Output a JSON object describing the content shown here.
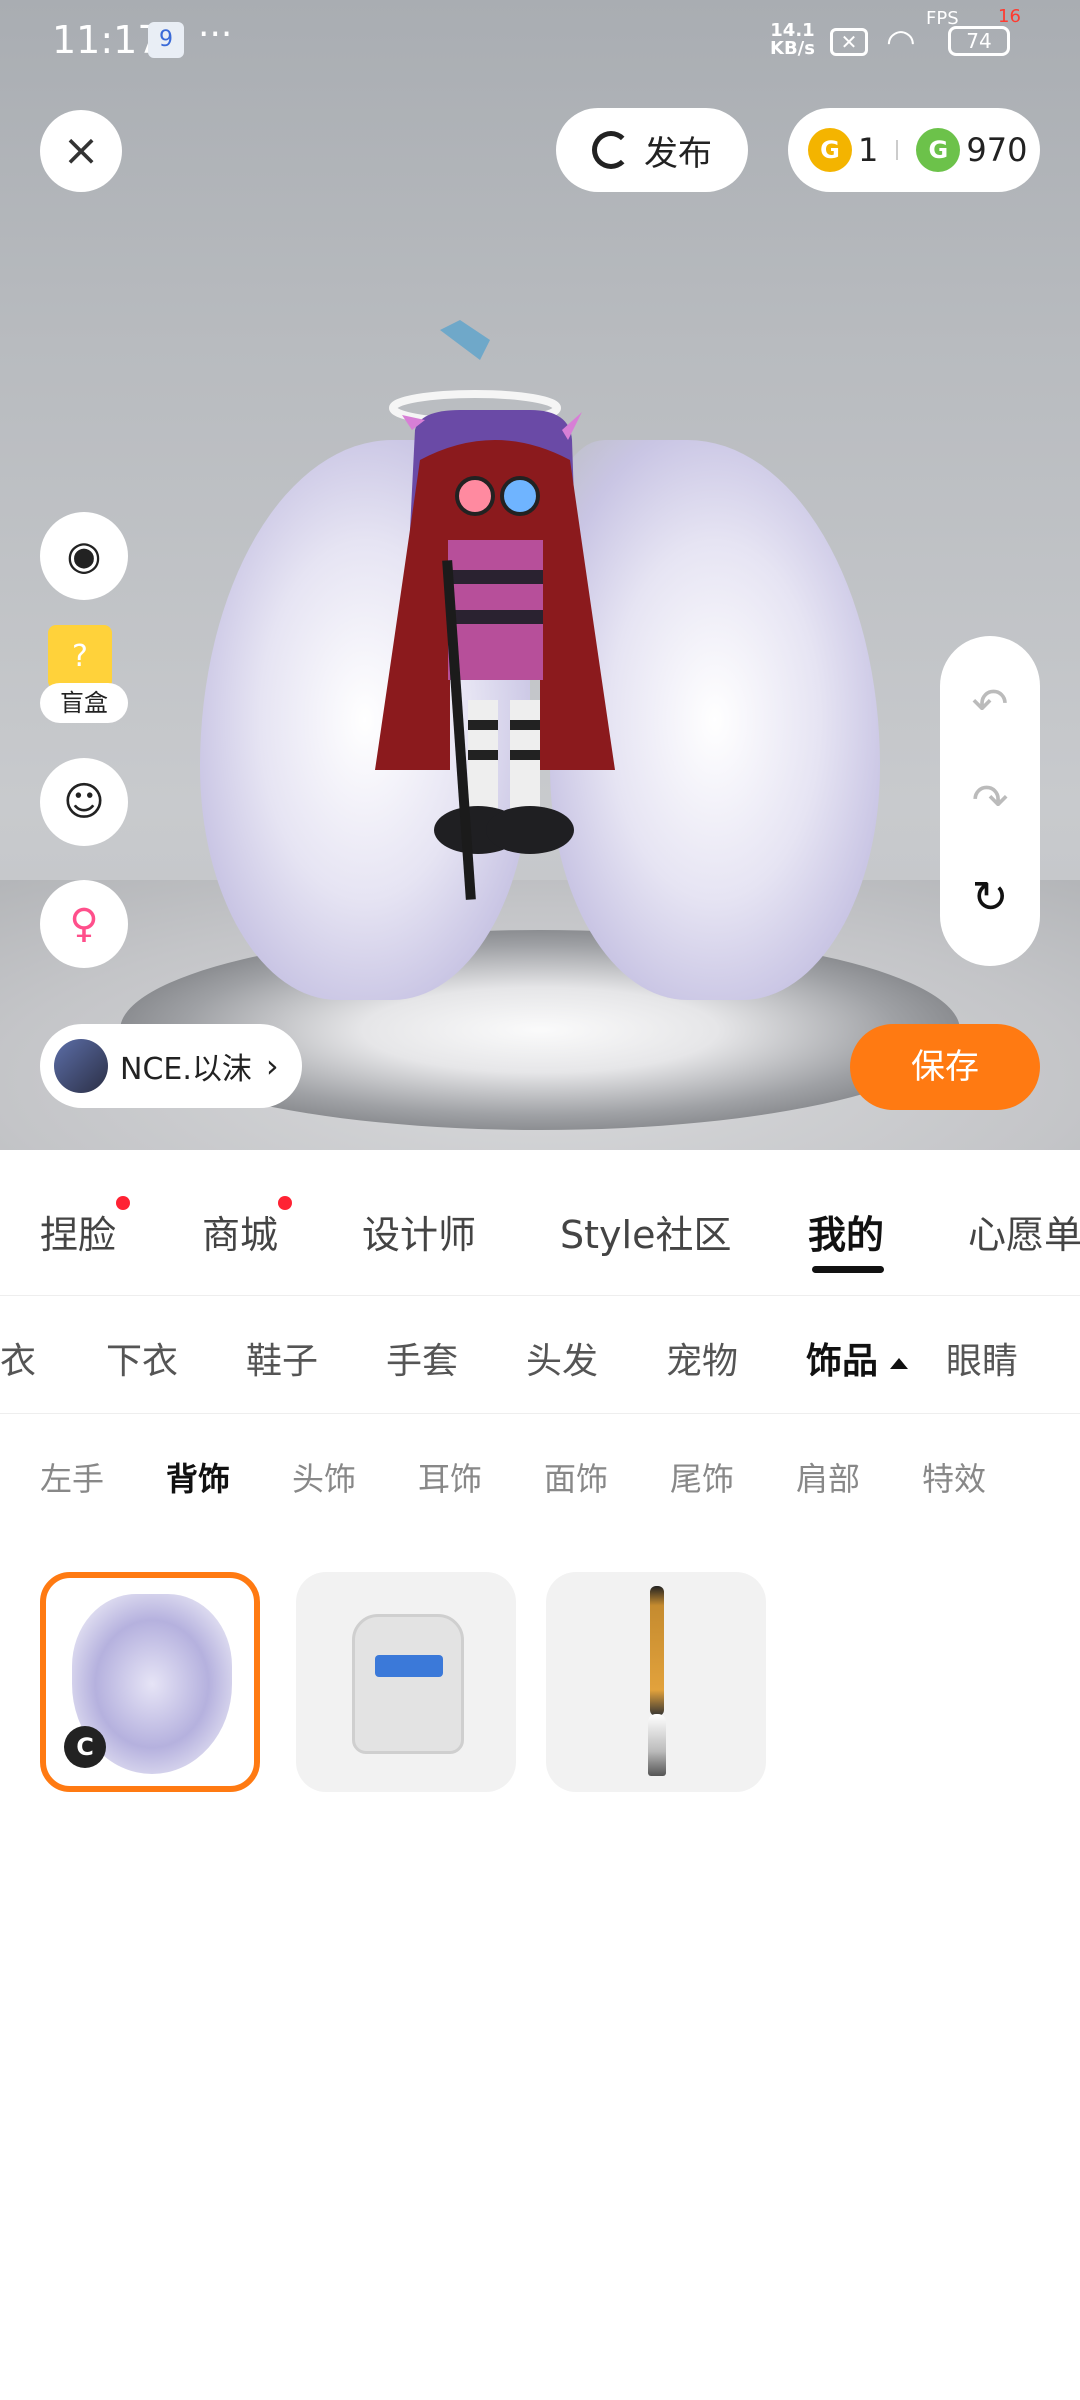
{
  "status_bar": {
    "time": "11:17",
    "notification_icon": "9",
    "more": "···",
    "net_speed_value": "14.1",
    "net_speed_unit": "KB/s",
    "fps_label": "FPS",
    "fps_value": "16",
    "battery": "74"
  },
  "top_bar": {
    "close": "×",
    "publish_label": "发布",
    "gold_coin_letter": "G",
    "gold_coin_count": "1",
    "green_coin_letter": "G",
    "green_coin_count": "970"
  },
  "side_tools": {
    "blind_box_label": "盲盒",
    "blind_box_icon": "?"
  },
  "undo_panel": {
    "undo": "↶",
    "redo": "↷",
    "reset": "↻"
  },
  "user": {
    "name": "NCE.以沫",
    "chevron": "›"
  },
  "save_label": "保存",
  "main_tabs": [
    "捏脸",
    "商城",
    "设计师",
    "Style社区",
    "我的",
    "心愿单"
  ],
  "main_tab_active": "我的",
  "category_tabs": [
    "上衣",
    "下衣",
    "鞋子",
    "手套",
    "头发",
    "宠物",
    "饰品",
    "眼睛"
  ],
  "category_active": "饰品",
  "sub_tabs": [
    "左手",
    "背饰",
    "头饰",
    "耳饰",
    "面饰",
    "尾饰",
    "肩部",
    "特效"
  ],
  "sub_active": "背饰",
  "items": [
    {
      "name": "wings",
      "badge": "C",
      "selected": true
    },
    {
      "name": "backpack",
      "selected": false
    },
    {
      "name": "brush",
      "selected": false
    }
  ],
  "colors": {
    "accent": "#ff7a12",
    "dot": "#ff2233"
  }
}
